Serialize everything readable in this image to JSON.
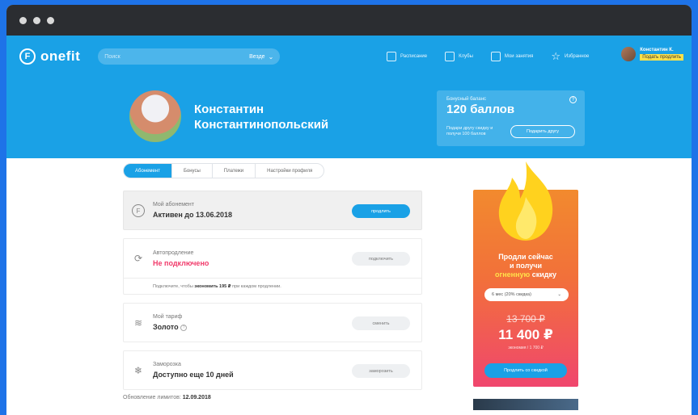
{
  "nav": {
    "logo": "onefit",
    "search_placeholder": "Поиск",
    "city": "Везде",
    "links": [
      "Расписание",
      "Клубы",
      "Мои занятия",
      "Избранное"
    ],
    "user_name": "Константин К.",
    "user_badge": "Подать продлить"
  },
  "profile": {
    "first_name": "Константин",
    "last_name": "Константинопольский"
  },
  "bonus": {
    "label": "Бонусный баланс",
    "value": "120 баллов",
    "desc": "Подари другу скидку и получи 100 баллов",
    "button": "Подарить другу"
  },
  "tabs": [
    "Абонемент",
    "Бонусы",
    "Платежи",
    "Настройки профиля"
  ],
  "cards": {
    "subscription": {
      "label": "Мой абонемент",
      "value": "Активен до 13.06.2018",
      "button": "продлить"
    },
    "autorenew": {
      "label": "Автопродление",
      "value": "Не подключено",
      "button": "подключить",
      "note_pre": "Подключите, чтобы",
      "note_bold": "экономить 195 ₽",
      "note_post": "при каждом продлении."
    },
    "tariff": {
      "label": "Мой тариф",
      "value": "Золото",
      "button": "сменить"
    },
    "freeze": {
      "label": "Заморозка",
      "value": "Доступно еще 10 дней",
      "button": "заморозить"
    }
  },
  "updated": {
    "label": "Обновление лимитов:",
    "date": "12.09.2018"
  },
  "promo": {
    "line1": "Продли сейчас",
    "line2": "и получи",
    "line3_hl": "огненную",
    "line3_rest": "скидку",
    "select": "6 мес (20% скидка)",
    "old_price": "13 700 ₽",
    "new_price": "11 400 ₽",
    "per_month": "экономия / 1 700 ₽",
    "button": "Продлить со скидкой"
  },
  "colors": {
    "brand": "#1aa1e6",
    "accent_red": "#f13b6b",
    "promo_top": "#f28a2e",
    "promo_bottom": "#f0466e",
    "highlight": "#ffe14a"
  }
}
